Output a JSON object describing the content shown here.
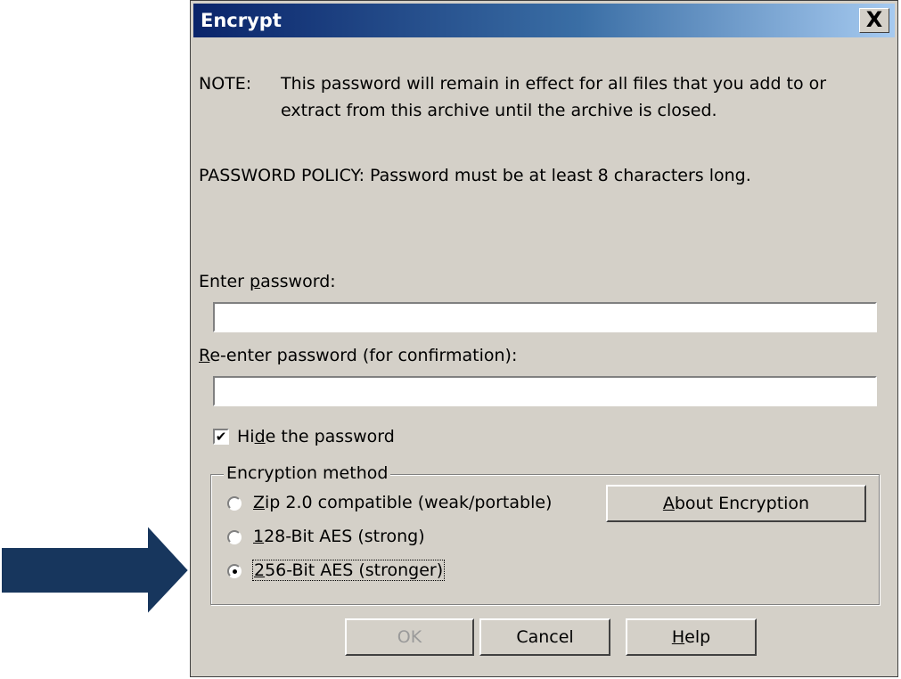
{
  "window": {
    "title": "Encrypt",
    "close_symbol": "X"
  },
  "note": {
    "label": "NOTE:",
    "line1": "This password will remain in effect for all files that you add to or",
    "line2": "extract from this archive until the archive is closed."
  },
  "policy": {
    "text": "PASSWORD POLICY: Password must be at least 8 characters long."
  },
  "password": {
    "label_pre": "Enter ",
    "label_key": "p",
    "label_post": "assword:",
    "value": ""
  },
  "confirm": {
    "label_key": "R",
    "label_post": "e-enter password (for confirmation):",
    "value": ""
  },
  "hide_password": {
    "checked": true,
    "check_mark": "✔",
    "label_pre": "Hi",
    "label_key": "d",
    "label_post": "e the password"
  },
  "encryption": {
    "group_label": "Encryption method",
    "options": [
      {
        "key": "Z",
        "rest": "ip 2.0 compatible (weak/portable)",
        "selected": false
      },
      {
        "key": "1",
        "rest": "28-Bit AES (strong)",
        "selected": false
      },
      {
        "key": "2",
        "rest": "56-Bit AES (stronger)",
        "selected": true
      }
    ],
    "about_key": "A",
    "about_rest": "bout Encryption"
  },
  "buttons": {
    "ok": "OK",
    "cancel": "Cancel",
    "help_key": "H",
    "help_rest": "elp"
  },
  "colors": {
    "arrow": "#17365d",
    "title_start": "#0a246a",
    "title_end": "#a6caf0",
    "dialog_bg": "#d4d0c8"
  }
}
